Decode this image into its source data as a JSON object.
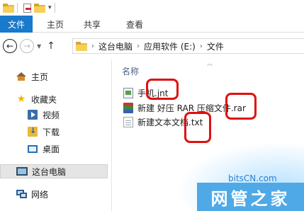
{
  "ribbon": {
    "file_tab": "文件",
    "tabs": [
      "主页",
      "共享",
      "查看"
    ]
  },
  "address": {
    "crumbs": [
      "这台电脑",
      "应用软件 (E:)",
      "文件"
    ]
  },
  "navpane": {
    "home": "主页",
    "favorites": "收藏夹",
    "videos": "视频",
    "downloads": "下载",
    "desktop": "桌面",
    "this_pc": "这台电脑",
    "network": "网络"
  },
  "content": {
    "column_name": "名称",
    "files": [
      {
        "name": "手机.jnt",
        "icon": "jnt-file-icon"
      },
      {
        "name": "新建 好压 RAR 压缩文件.rar",
        "icon": "rar-archive-icon"
      },
      {
        "name": "新建文本文档.txt",
        "icon": "text-file-icon"
      }
    ]
  },
  "watermark": {
    "site": "bitsCN.com",
    "brand": "网管之家"
  },
  "colors": {
    "accent": "#1979ca",
    "annotation": "#e01010",
    "watermark_banner": "#4fa9e6"
  }
}
